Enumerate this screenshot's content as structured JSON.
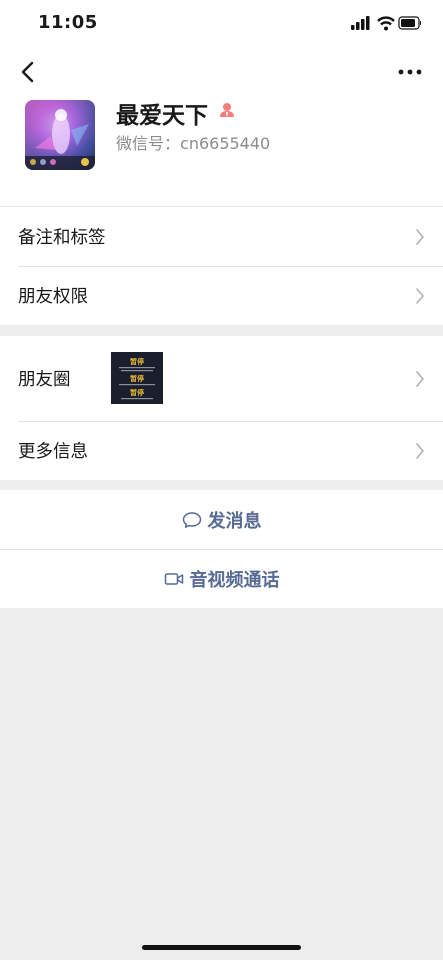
{
  "status_bar": {
    "time": "11:05"
  },
  "profile": {
    "name": "最爱天下",
    "wechat_id_label": "微信号：",
    "wechat_id": "cn6655440"
  },
  "menu": {
    "remarks_tags": "备注和标签",
    "friend_permissions": "朋友权限",
    "moments": "朋友圈",
    "more_info": "更多信息"
  },
  "moments_thumb": {
    "title_text": "暂停"
  },
  "actions": {
    "send_message": "发消息",
    "video_call": "音视频通话"
  },
  "colors": {
    "link_blue": "#576b95",
    "gender_pink": "#f37e7d",
    "background": "#ededed"
  }
}
